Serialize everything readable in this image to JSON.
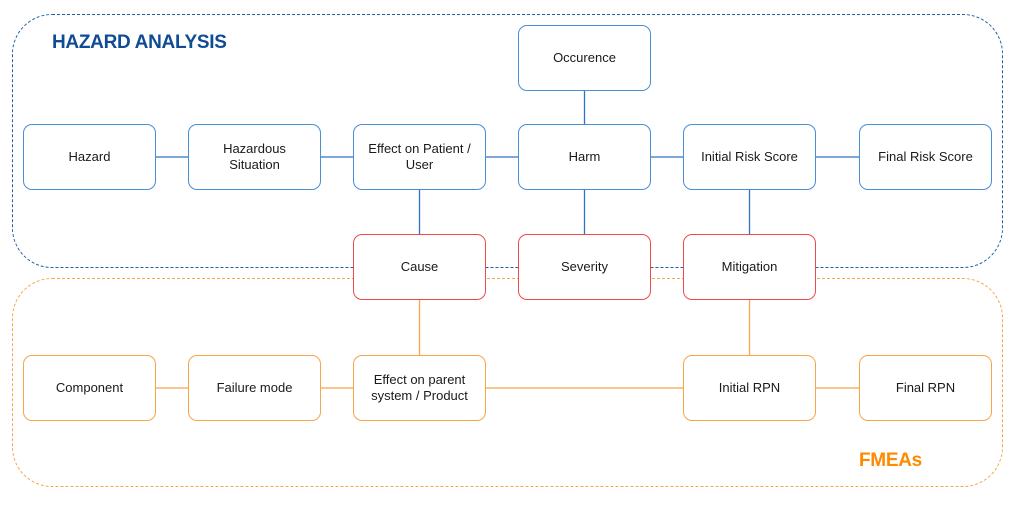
{
  "groups": {
    "hazard": {
      "title": "HAZARD ANALYSIS",
      "color": "#0f4c94"
    },
    "fmea": {
      "title": "FMEAs",
      "color": "#ff8a00"
    }
  },
  "nodes": {
    "occurence": "Occurence",
    "hazard": "Hazard",
    "hazardous_situation": "Hazardous Situation",
    "effect_on_patient": "Effect on Patient / User",
    "harm": "Harm",
    "initial_risk_score": "Initial Risk Score",
    "final_risk_score": "Final Risk Score",
    "cause": "Cause",
    "severity": "Severity",
    "mitigation": "Mitigation",
    "component": "Component",
    "failure_mode": "Failure mode",
    "effect_on_parent": "Effect on parent system / Product",
    "initial_rpn": "Initial RPN",
    "final_rpn": "Final RPN"
  },
  "edges": [
    [
      "hazard",
      "hazardous_situation"
    ],
    [
      "hazardous_situation",
      "effect_on_patient"
    ],
    [
      "effect_on_patient",
      "harm"
    ],
    [
      "harm",
      "initial_risk_score"
    ],
    [
      "initial_risk_score",
      "final_risk_score"
    ],
    [
      "occurence",
      "harm"
    ],
    [
      "effect_on_patient",
      "cause"
    ],
    [
      "harm",
      "severity"
    ],
    [
      "initial_risk_score",
      "mitigation"
    ],
    [
      "cause",
      "effect_on_parent"
    ],
    [
      "mitigation",
      "initial_rpn"
    ],
    [
      "component",
      "failure_mode"
    ],
    [
      "failure_mode",
      "effect_on_parent"
    ],
    [
      "effect_on_parent",
      "initial_rpn"
    ],
    [
      "initial_rpn",
      "final_rpn"
    ]
  ],
  "colors": {
    "hazard_node": "#4a8fd6",
    "shared_node": "#ee4a4e",
    "fmea_node": "#f7a54a"
  }
}
